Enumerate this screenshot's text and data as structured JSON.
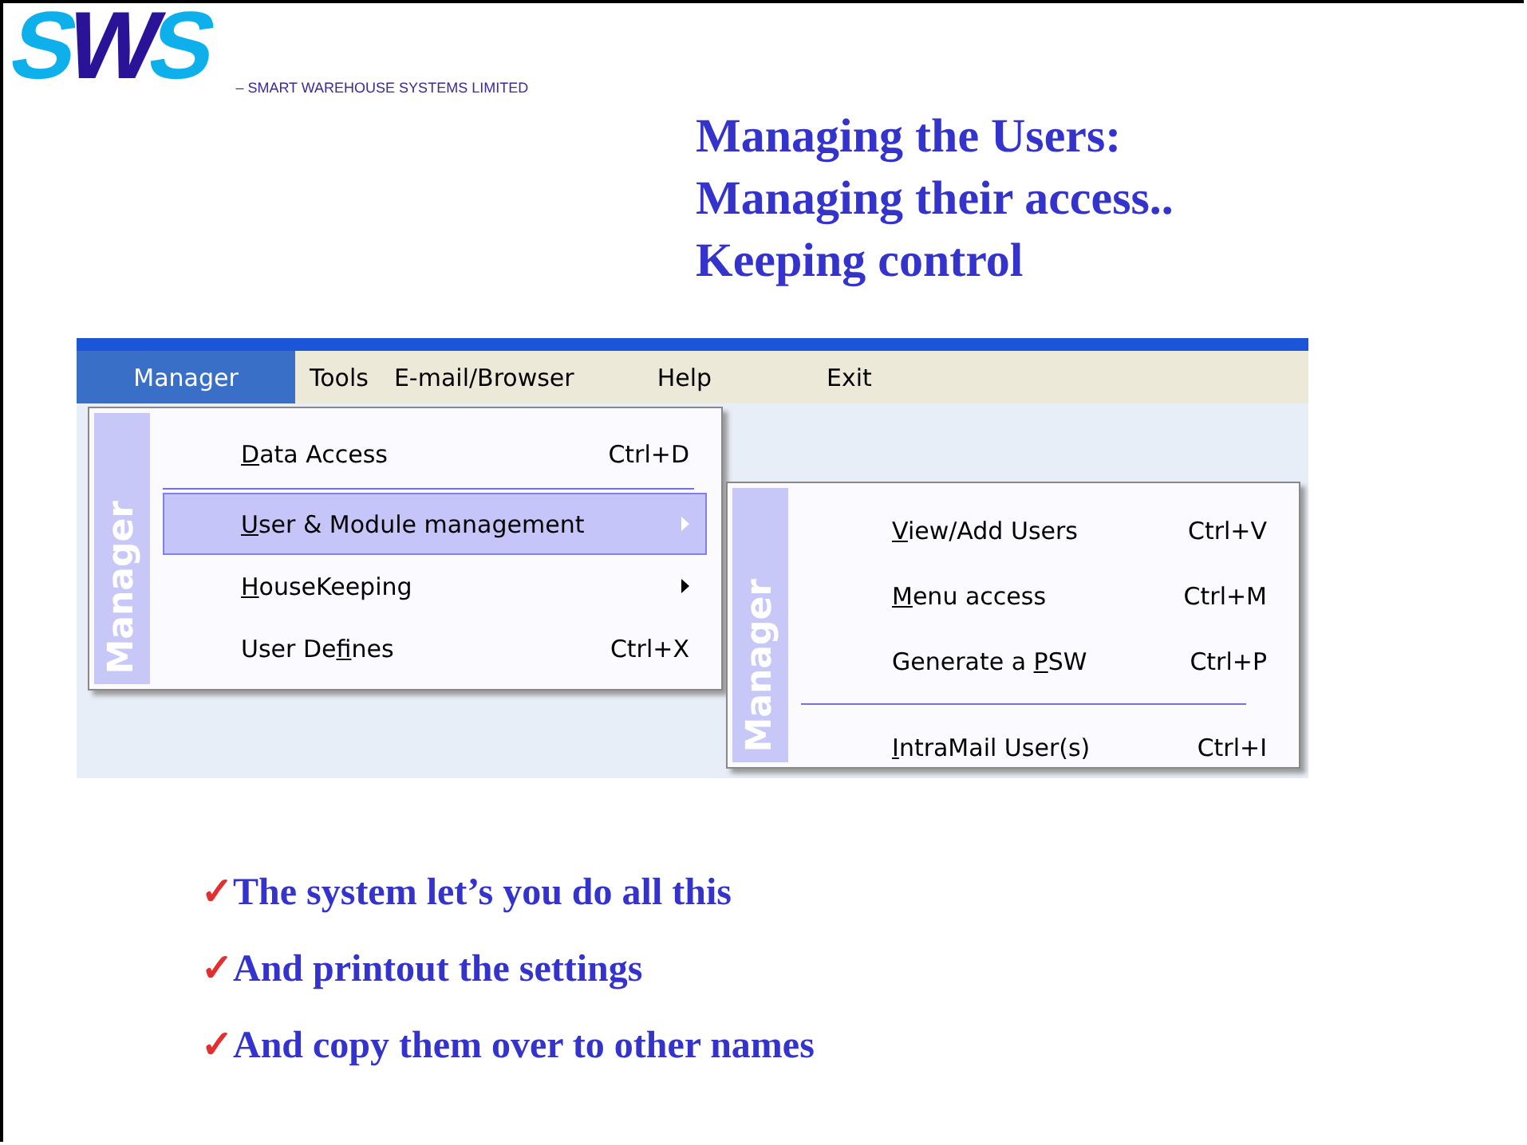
{
  "logo": {
    "letters": "SWS",
    "tagline": "– SMART WAREHOUSE SYSTEMS LIMITED"
  },
  "title_lines": [
    "Managing the Users:",
    "Managing their access..",
    "Keeping control"
  ],
  "screenshot": {
    "menubar": [
      {
        "label": "Manager",
        "selected": true
      },
      {
        "label": "Tools",
        "selected": false
      },
      {
        "label": "E-mail/Browser",
        "selected": false
      },
      {
        "label": "Help",
        "selected": false
      },
      {
        "label": "Exit",
        "selected": false
      }
    ],
    "menu": {
      "side_label": "Manager",
      "items": [
        {
          "kind": "item",
          "key": "D",
          "rest": "ata Access",
          "shortcut": "Ctrl+D",
          "selected": false,
          "submenu": false
        },
        {
          "kind": "separator"
        },
        {
          "kind": "item",
          "key": "U",
          "rest": "ser & Module management",
          "selected": true,
          "submenu": true
        },
        {
          "kind": "item",
          "key": "H",
          "rest": "ouseKeeping",
          "selected": false,
          "submenu": true
        },
        {
          "kind": "item",
          "prefix": "User De",
          "key": "f",
          "rest": "ines",
          "shortcut": "Ctrl+X",
          "selected": false,
          "submenu": false
        }
      ]
    },
    "submenu": {
      "side_label": "Manager",
      "items": [
        {
          "kind": "item",
          "key": "V",
          "rest": "iew/Add Users",
          "shortcut": "Ctrl+V",
          "selected": false,
          "submenu": false
        },
        {
          "kind": "item",
          "key": "M",
          "rest": "enu access",
          "shortcut": "Ctrl+M",
          "selected": false,
          "submenu": false
        },
        {
          "kind": "item",
          "prefix": "Generate a ",
          "key": "P",
          "rest": "SW",
          "shortcut": "Ctrl+P",
          "selected": false,
          "submenu": false
        },
        {
          "kind": "separator"
        },
        {
          "kind": "item",
          "key": "I",
          "rest": "ntraMail User(s)",
          "shortcut": "Ctrl+I",
          "selected": false,
          "submenu": false
        }
      ]
    }
  },
  "bullets": [
    {
      "check": "✓",
      "text": "The system let’s you do all this"
    },
    {
      "check": "✓",
      "text": "And printout the settings"
    },
    {
      "check": "✓",
      "text": "And copy them over to other names"
    }
  ]
}
